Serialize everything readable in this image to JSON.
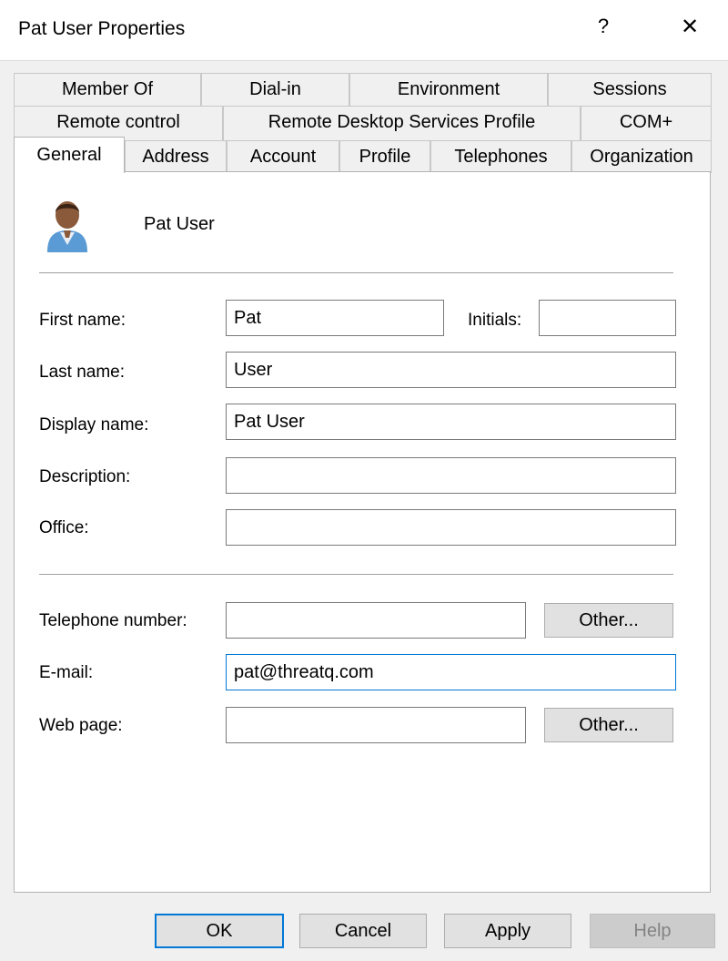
{
  "window": {
    "title": "Pat User Properties",
    "help_glyph": "?",
    "close_glyph": "✕"
  },
  "tabs": {
    "row1": [
      "Member Of",
      "Dial-in",
      "Environment",
      "Sessions"
    ],
    "row2": [
      "Remote control",
      "Remote Desktop Services Profile",
      "COM+"
    ],
    "row3": [
      "General",
      "Address",
      "Account",
      "Profile",
      "Telephones",
      "Organization"
    ],
    "active": "General"
  },
  "general": {
    "user_icon": "user-avatar-icon",
    "display_header": "Pat User",
    "labels": {
      "first_name": "First name:",
      "initials": "Initials:",
      "last_name": "Last name:",
      "display_name": "Display name:",
      "description": "Description:",
      "office": "Office:",
      "telephone": "Telephone number:",
      "email": "E-mail:",
      "web_page": "Web page:"
    },
    "values": {
      "first_name": "Pat",
      "initials": "",
      "last_name": "User",
      "display_name": "Pat User",
      "description": "",
      "office": "",
      "telephone": "",
      "email": "pat@threatq.com",
      "web_page": ""
    },
    "other_telephone_label": "Other...",
    "other_web_label": "Other..."
  },
  "footer": {
    "ok": "OK",
    "cancel": "Cancel",
    "apply": "Apply",
    "help": "Help"
  },
  "colors": {
    "focus": "#0078d7",
    "avatar_shirt": "#5b9bd5",
    "avatar_skin": "#8a5a3a"
  }
}
